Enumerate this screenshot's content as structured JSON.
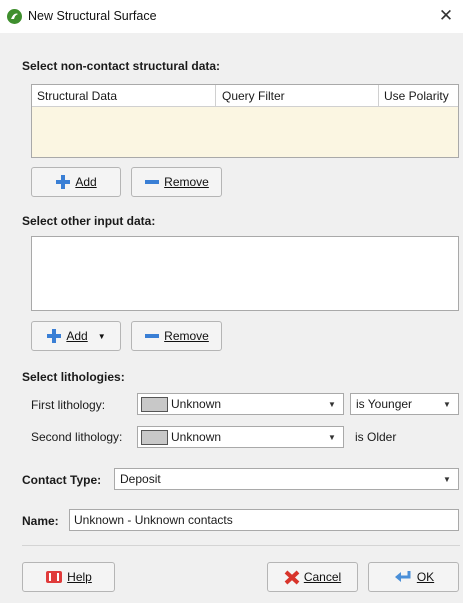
{
  "window": {
    "title": "New Structural Surface",
    "close_glyph": "✕"
  },
  "structural": {
    "section_label": "Select non-contact structural data:",
    "columns": [
      "Structural Data",
      "Query Filter",
      "Use Polarity"
    ],
    "add_label": "Add",
    "remove_label": "Remove"
  },
  "other_input": {
    "section_label": "Select other input data:",
    "add_label": "Add",
    "remove_label": "Remove"
  },
  "lithologies": {
    "section_label": "Select lithologies:",
    "first_label": "First lithology:",
    "first_value": "Unknown",
    "first_relation": "is Younger",
    "second_label": "Second lithology:",
    "second_value": "Unknown",
    "second_relation": "is Older"
  },
  "contact_type": {
    "label": "Contact Type:",
    "value": "Deposit"
  },
  "name": {
    "label": "Name:",
    "value": "Unknown - Unknown contacts"
  },
  "footer": {
    "help_label": "Help",
    "cancel_label": "Cancel",
    "ok_label": "OK"
  }
}
